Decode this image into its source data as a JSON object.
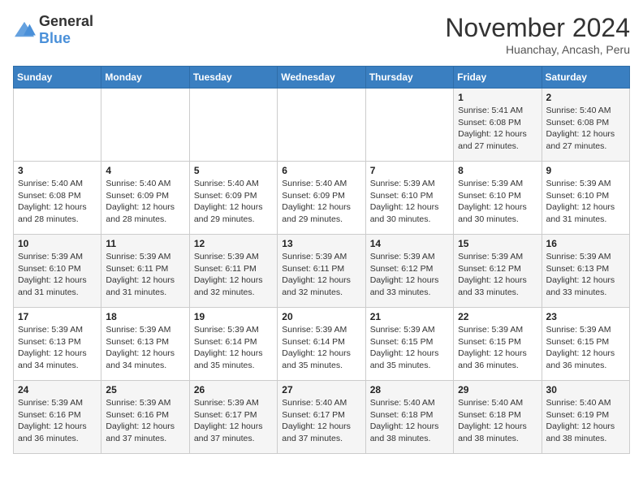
{
  "header": {
    "logo": {
      "text_general": "General",
      "text_blue": "Blue"
    },
    "title": "November 2024",
    "location": "Huanchay, Ancash, Peru"
  },
  "days_of_week": [
    "Sunday",
    "Monday",
    "Tuesday",
    "Wednesday",
    "Thursday",
    "Friday",
    "Saturday"
  ],
  "weeks": [
    [
      {
        "day": "",
        "info": ""
      },
      {
        "day": "",
        "info": ""
      },
      {
        "day": "",
        "info": ""
      },
      {
        "day": "",
        "info": ""
      },
      {
        "day": "",
        "info": ""
      },
      {
        "day": "1",
        "info": "Sunrise: 5:41 AM\nSunset: 6:08 PM\nDaylight: 12 hours and 27 minutes."
      },
      {
        "day": "2",
        "info": "Sunrise: 5:40 AM\nSunset: 6:08 PM\nDaylight: 12 hours and 27 minutes."
      }
    ],
    [
      {
        "day": "3",
        "info": "Sunrise: 5:40 AM\nSunset: 6:08 PM\nDaylight: 12 hours and 28 minutes."
      },
      {
        "day": "4",
        "info": "Sunrise: 5:40 AM\nSunset: 6:09 PM\nDaylight: 12 hours and 28 minutes."
      },
      {
        "day": "5",
        "info": "Sunrise: 5:40 AM\nSunset: 6:09 PM\nDaylight: 12 hours and 29 minutes."
      },
      {
        "day": "6",
        "info": "Sunrise: 5:40 AM\nSunset: 6:09 PM\nDaylight: 12 hours and 29 minutes."
      },
      {
        "day": "7",
        "info": "Sunrise: 5:39 AM\nSunset: 6:10 PM\nDaylight: 12 hours and 30 minutes."
      },
      {
        "day": "8",
        "info": "Sunrise: 5:39 AM\nSunset: 6:10 PM\nDaylight: 12 hours and 30 minutes."
      },
      {
        "day": "9",
        "info": "Sunrise: 5:39 AM\nSunset: 6:10 PM\nDaylight: 12 hours and 31 minutes."
      }
    ],
    [
      {
        "day": "10",
        "info": "Sunrise: 5:39 AM\nSunset: 6:10 PM\nDaylight: 12 hours and 31 minutes."
      },
      {
        "day": "11",
        "info": "Sunrise: 5:39 AM\nSunset: 6:11 PM\nDaylight: 12 hours and 31 minutes."
      },
      {
        "day": "12",
        "info": "Sunrise: 5:39 AM\nSunset: 6:11 PM\nDaylight: 12 hours and 32 minutes."
      },
      {
        "day": "13",
        "info": "Sunrise: 5:39 AM\nSunset: 6:11 PM\nDaylight: 12 hours and 32 minutes."
      },
      {
        "day": "14",
        "info": "Sunrise: 5:39 AM\nSunset: 6:12 PM\nDaylight: 12 hours and 33 minutes."
      },
      {
        "day": "15",
        "info": "Sunrise: 5:39 AM\nSunset: 6:12 PM\nDaylight: 12 hours and 33 minutes."
      },
      {
        "day": "16",
        "info": "Sunrise: 5:39 AM\nSunset: 6:13 PM\nDaylight: 12 hours and 33 minutes."
      }
    ],
    [
      {
        "day": "17",
        "info": "Sunrise: 5:39 AM\nSunset: 6:13 PM\nDaylight: 12 hours and 34 minutes."
      },
      {
        "day": "18",
        "info": "Sunrise: 5:39 AM\nSunset: 6:13 PM\nDaylight: 12 hours and 34 minutes."
      },
      {
        "day": "19",
        "info": "Sunrise: 5:39 AM\nSunset: 6:14 PM\nDaylight: 12 hours and 35 minutes."
      },
      {
        "day": "20",
        "info": "Sunrise: 5:39 AM\nSunset: 6:14 PM\nDaylight: 12 hours and 35 minutes."
      },
      {
        "day": "21",
        "info": "Sunrise: 5:39 AM\nSunset: 6:15 PM\nDaylight: 12 hours and 35 minutes."
      },
      {
        "day": "22",
        "info": "Sunrise: 5:39 AM\nSunset: 6:15 PM\nDaylight: 12 hours and 36 minutes."
      },
      {
        "day": "23",
        "info": "Sunrise: 5:39 AM\nSunset: 6:15 PM\nDaylight: 12 hours and 36 minutes."
      }
    ],
    [
      {
        "day": "24",
        "info": "Sunrise: 5:39 AM\nSunset: 6:16 PM\nDaylight: 12 hours and 36 minutes."
      },
      {
        "day": "25",
        "info": "Sunrise: 5:39 AM\nSunset: 6:16 PM\nDaylight: 12 hours and 37 minutes."
      },
      {
        "day": "26",
        "info": "Sunrise: 5:39 AM\nSunset: 6:17 PM\nDaylight: 12 hours and 37 minutes."
      },
      {
        "day": "27",
        "info": "Sunrise: 5:40 AM\nSunset: 6:17 PM\nDaylight: 12 hours and 37 minutes."
      },
      {
        "day": "28",
        "info": "Sunrise: 5:40 AM\nSunset: 6:18 PM\nDaylight: 12 hours and 38 minutes."
      },
      {
        "day": "29",
        "info": "Sunrise: 5:40 AM\nSunset: 6:18 PM\nDaylight: 12 hours and 38 minutes."
      },
      {
        "day": "30",
        "info": "Sunrise: 5:40 AM\nSunset: 6:19 PM\nDaylight: 12 hours and 38 minutes."
      }
    ]
  ]
}
